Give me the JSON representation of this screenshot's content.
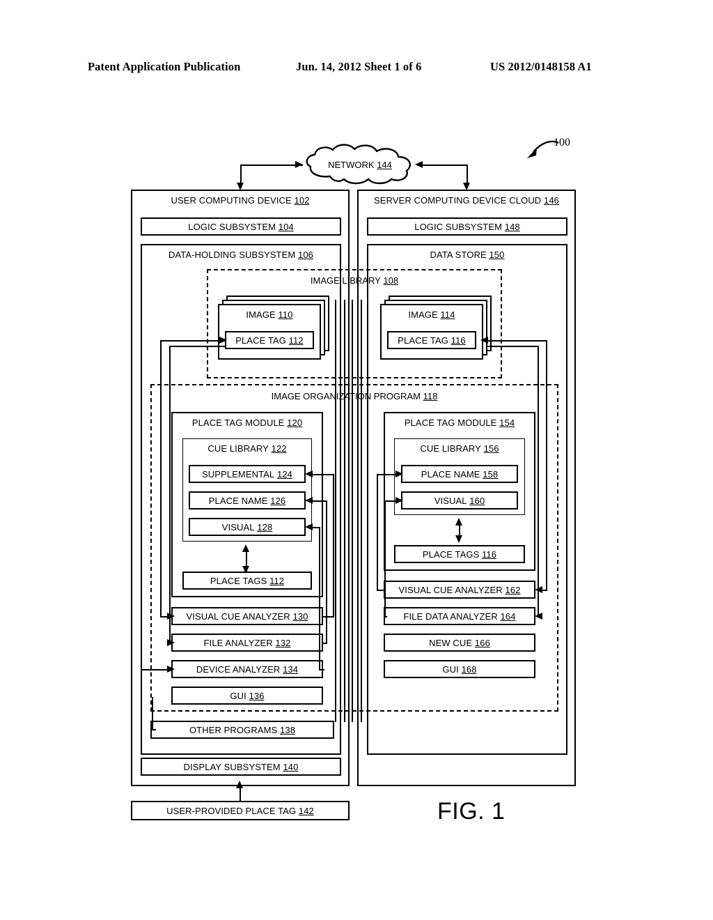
{
  "header": {
    "publication": "Patent Application Publication",
    "date_sheet": "Jun. 14, 2012  Sheet 1 of 6",
    "pub_number": "US 2012/0148158 A1"
  },
  "figure": {
    "label": "FIG. 1",
    "system_ref": "100"
  },
  "network": {
    "label": "NETWORK",
    "ref": "144"
  },
  "left_column": {
    "title": {
      "label": "USER COMPUTING DEVICE",
      "ref": "102"
    },
    "logic_subsystem": {
      "label": "LOGIC SUBSYSTEM",
      "ref": "104"
    },
    "data_holding_subsystem": {
      "label": "DATA-HOLDING SUBSYSTEM",
      "ref": "106"
    },
    "image": {
      "label": "IMAGE",
      "ref": "110"
    },
    "place_tag": {
      "label": "PLACE TAG",
      "ref": "112"
    },
    "place_tag_module": {
      "label": "PLACE TAG MODULE",
      "ref": "120"
    },
    "cue_library": {
      "label": "CUE LIBRARY",
      "ref": "122"
    },
    "supplemental": {
      "label": "SUPPLEMENTAL",
      "ref": "124"
    },
    "place_name": {
      "label": "PLACE NAME",
      "ref": "126"
    },
    "visual": {
      "label": "VISUAL",
      "ref": "128"
    },
    "place_tags": {
      "label": "PLACE TAGS",
      "ref": "112"
    },
    "visual_cue_analyzer": {
      "label": "VISUAL CUE ANALYZER",
      "ref": "130"
    },
    "file_analyzer": {
      "label": "FILE ANALYZER",
      "ref": "132"
    },
    "device_analyzer": {
      "label": "DEVICE ANALYZER",
      "ref": "134"
    },
    "gui": {
      "label": "GUI",
      "ref": "136"
    },
    "other_programs": {
      "label": "OTHER PROGRAMS",
      "ref": "138"
    },
    "display_subsystem": {
      "label": "DISPLAY SUBSYSTEM",
      "ref": "140"
    },
    "user_provided_place_tag": {
      "label": "USER-PROVIDED PLACE TAG",
      "ref": "142"
    }
  },
  "right_column": {
    "title": {
      "label": "SERVER COMPUTING DEVICE CLOUD",
      "ref": "146"
    },
    "logic_subsystem": {
      "label": "LOGIC SUBSYSTEM",
      "ref": "148"
    },
    "data_store": {
      "label": "DATA STORE",
      "ref": "150"
    },
    "image": {
      "label": "IMAGE",
      "ref": "114"
    },
    "place_tag": {
      "label": "PLACE TAG",
      "ref": "116"
    },
    "place_tag_module": {
      "label": "PLACE TAG MODULE",
      "ref": "154"
    },
    "cue_library": {
      "label": "CUE LIBRARY",
      "ref": "156"
    },
    "place_name": {
      "label": "PLACE NAME",
      "ref": "158"
    },
    "visual": {
      "label": "VISUAL",
      "ref": "160"
    },
    "place_tags": {
      "label": "PLACE TAGS",
      "ref": "116"
    },
    "visual_cue_analyzer": {
      "label": "VISUAL CUE ANALYZER",
      "ref": "162"
    },
    "file_data_analyzer": {
      "label": "FILE DATA ANALYZER",
      "ref": "164"
    },
    "new_cue": {
      "label": "NEW CUE",
      "ref": "166"
    },
    "gui": {
      "label": "GUI",
      "ref": "168"
    }
  },
  "shared": {
    "image_library": {
      "label": "IMAGE LIBRARY",
      "ref": "108"
    },
    "image_organization_program": {
      "label": "IMAGE ORGANIZATION PROGRAM",
      "ref": "118"
    }
  }
}
